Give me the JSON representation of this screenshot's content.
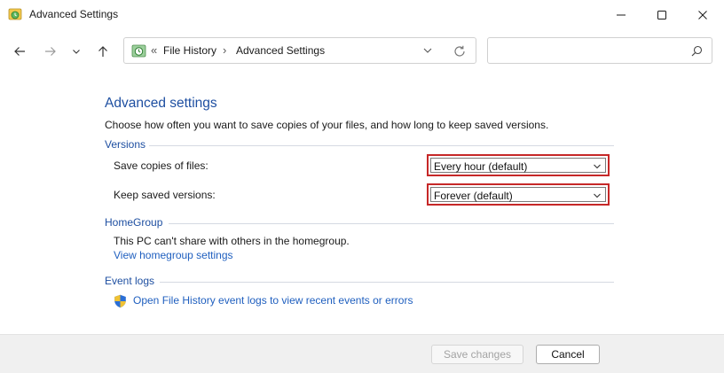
{
  "window": {
    "title": "Advanced Settings"
  },
  "address_bar": {
    "overflow_glyph": "«",
    "crumbs": [
      "File History",
      "Advanced Settings"
    ],
    "separator": "›"
  },
  "search": {
    "placeholder": ""
  },
  "content": {
    "title": "Advanced settings",
    "description": "Choose how often you want to save copies of your files, and how long to keep saved versions.",
    "versions": {
      "heading": "Versions",
      "save_copies_label": "Save copies of files:",
      "save_copies_value": "Every hour (default)",
      "keep_versions_label": "Keep saved versions:",
      "keep_versions_value": "Forever (default)"
    },
    "homegroup": {
      "heading": "HomeGroup",
      "message": "This PC can't share with others in the homegroup.",
      "link": "View homegroup settings"
    },
    "event_logs": {
      "heading": "Event logs",
      "link": "Open File History event logs to view recent events or errors"
    }
  },
  "footer": {
    "save_label": "Save changes",
    "cancel_label": "Cancel"
  },
  "colors": {
    "heading_blue": "#1e4fa1",
    "link_blue": "#1f5fbf",
    "highlight_red": "#c62828"
  },
  "icons": {
    "app": "file-history-icon",
    "back": "arrow-left-icon",
    "forward": "arrow-right-icon",
    "recent": "chevron-down-icon",
    "up": "arrow-up-icon",
    "refresh": "refresh-icon",
    "search": "search-icon",
    "shield": "shield-icon"
  }
}
